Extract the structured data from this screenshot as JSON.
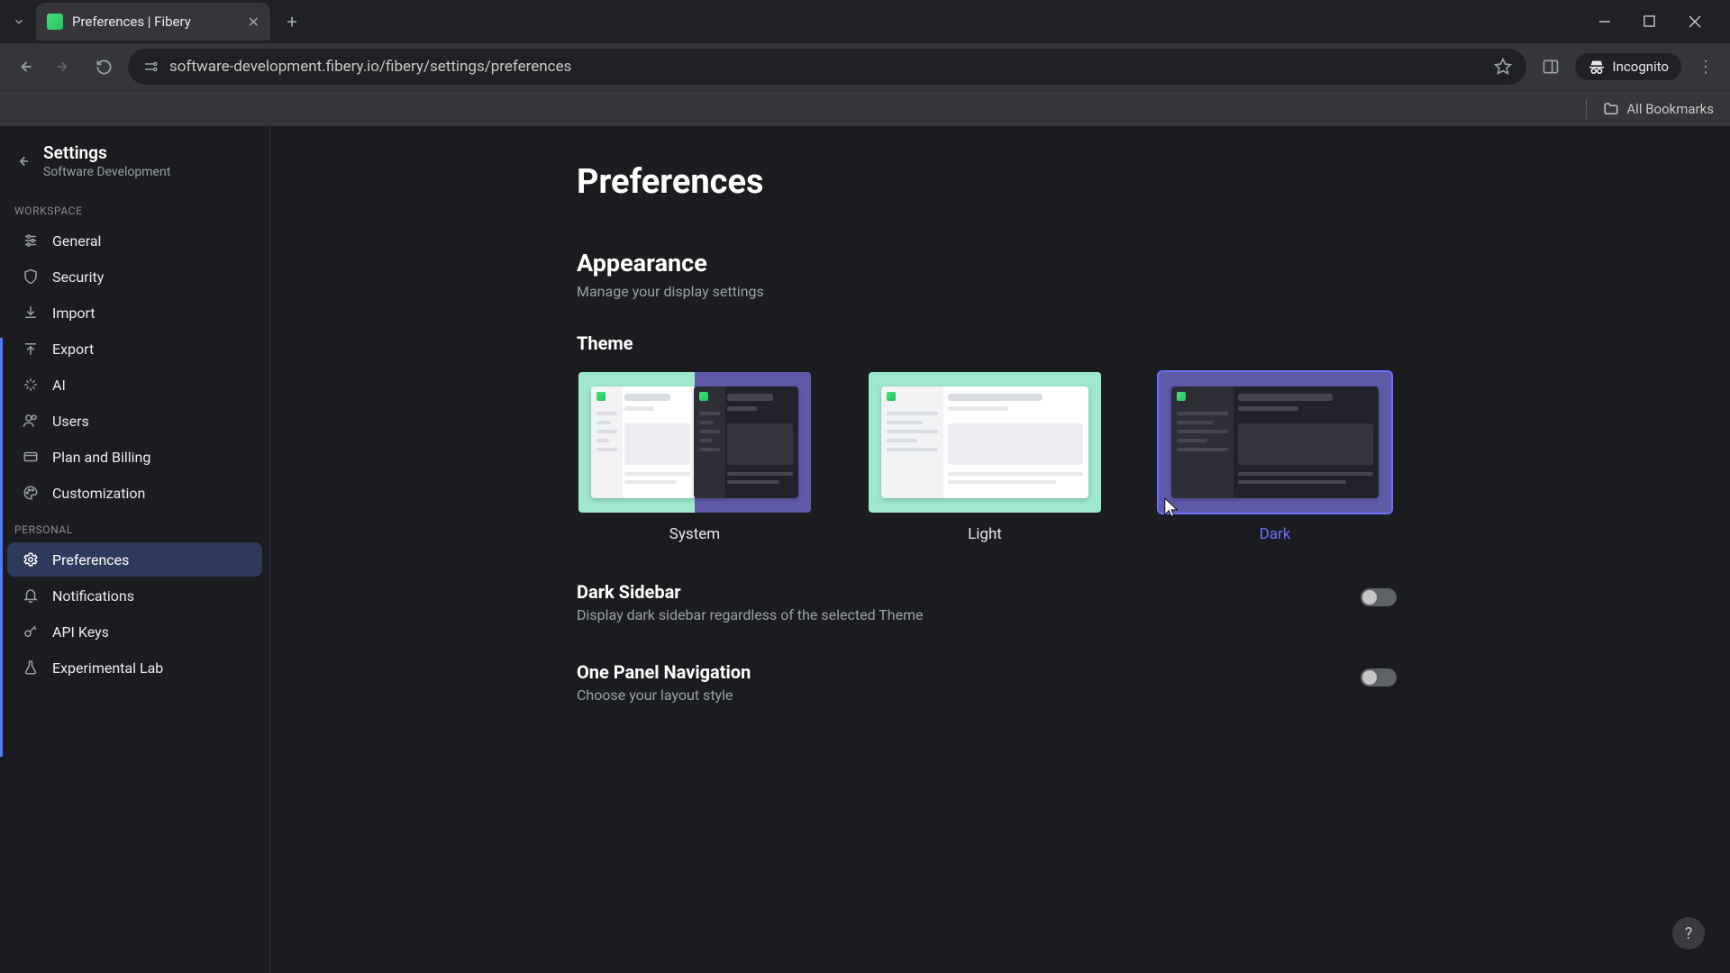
{
  "browser": {
    "tab_title": "Preferences | Fibery",
    "url": "software-development.fibery.io/fibery/settings/preferences",
    "incognito_label": "Incognito",
    "all_bookmarks": "All Bookmarks"
  },
  "sidebar": {
    "title": "Settings",
    "subtitle": "Software Development",
    "sections": {
      "workspace_label": "WORKSPACE",
      "personal_label": "PERSONAL"
    },
    "workspace": [
      {
        "key": "general",
        "label": "General"
      },
      {
        "key": "security",
        "label": "Security"
      },
      {
        "key": "import",
        "label": "Import"
      },
      {
        "key": "export",
        "label": "Export"
      },
      {
        "key": "ai",
        "label": "AI"
      },
      {
        "key": "users",
        "label": "Users"
      },
      {
        "key": "plan",
        "label": "Plan and Billing"
      },
      {
        "key": "customization",
        "label": "Customization"
      }
    ],
    "personal": [
      {
        "key": "preferences",
        "label": "Preferences",
        "active": true
      },
      {
        "key": "notifications",
        "label": "Notifications"
      },
      {
        "key": "apikeys",
        "label": "API Keys"
      },
      {
        "key": "lab",
        "label": "Experimental Lab"
      }
    ]
  },
  "page": {
    "title": "Preferences",
    "appearance": {
      "title": "Appearance",
      "desc": "Manage your display settings",
      "theme_label": "Theme",
      "themes": [
        {
          "label": "System",
          "selected": false
        },
        {
          "label": "Light",
          "selected": false
        },
        {
          "label": "Dark",
          "selected": true
        }
      ]
    },
    "dark_sidebar": {
      "title": "Dark Sidebar",
      "desc": "Display dark sidebar regardless of the selected Theme",
      "value": false
    },
    "one_panel": {
      "title": "One Panel Navigation",
      "desc": "Choose your layout style",
      "value": false
    }
  },
  "help_label": "?"
}
